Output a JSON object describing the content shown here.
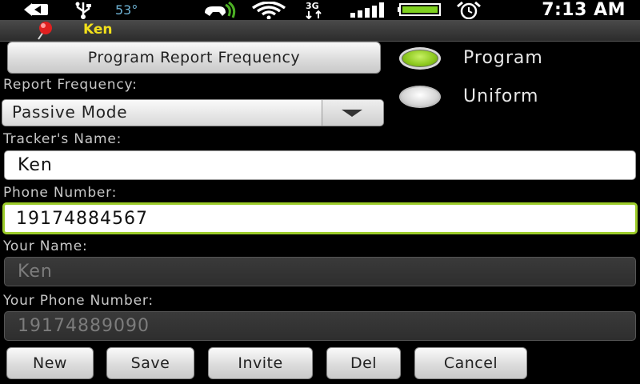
{
  "status_bar": {
    "temperature": "53°",
    "network": "3G",
    "time": "7:13 AM",
    "icons": [
      "back-arrow-icon",
      "usb-icon",
      "phone-icon",
      "wifi-icon",
      "network-3g-icon",
      "signal-icon",
      "battery-icon",
      "alarm-icon"
    ]
  },
  "title_bar": {
    "title": "Ken",
    "icon": "map-pin-icon"
  },
  "form": {
    "program_button": "Program Report Frequency",
    "report_frequency_label": "Report Frequency:",
    "report_frequency_value": "Passive Mode",
    "trackers_name_label": "Tracker's Name:",
    "trackers_name_value": "Ken",
    "phone_number_label": "Phone Number:",
    "phone_number_value": "19174884567",
    "your_name_label": "Your Name:",
    "your_name_value": "Ken",
    "your_phone_label": "Your Phone Number:",
    "your_phone_value": "19174889090"
  },
  "radios": {
    "program_label": "Program",
    "uniform_label": "Uniform",
    "selected": "Program"
  },
  "buttons": {
    "new": "New",
    "save": "Save",
    "invite": "Invite",
    "del": "Del",
    "cancel": "Cancel"
  },
  "colors": {
    "title_text": "#f2e01b",
    "focus_accent": "#9ccc2a",
    "radio_on": "#8cc81e"
  }
}
